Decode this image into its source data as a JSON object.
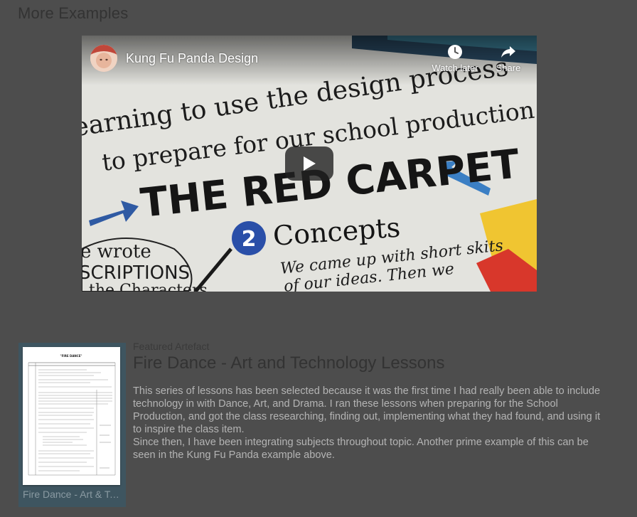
{
  "section": {
    "title": "More Examples"
  },
  "video": {
    "title": "Kung Fu Panda Design",
    "watch_later_label": "Watch later",
    "share_label": "Share",
    "whiteboard_lines": [
      "earning to use the design process",
      "to prepare for our school production",
      "THE RED CARPET",
      "Concepts",
      "We came up with short skits",
      "of our ideas. Then we",
      "e wrote",
      "SCRIPTIONS",
      "the Characters"
    ],
    "whiteboard_number": "2",
    "icons": [
      "clock-icon",
      "share-arrow-icon",
      "play-icon"
    ]
  },
  "featured": {
    "kicker": "Featured Artefact",
    "title": "Fire Dance - Art and Technology Lessons",
    "paragraph_1": "This series of lessons has been selected because it was the first time I had really been able to include technology in with Dance, Art, and Drama. I ran these lessons when preparing for the School Production, and got the class researching, finding out, implementing what they had found, and using it to inspire the class item.",
    "paragraph_2": "Since then, I have been integrating subjects throughout topic. Another prime example of this can be seen in the Kung Fu Panda example above.",
    "card_label": "Fire Dance - Art & Technology Lessons",
    "thumb_heading": "\"FIRE DANCE\""
  },
  "colors": {
    "background": "#4d4d4d",
    "card_background": "#3e5560",
    "body_text": "#b4b4b4",
    "heading_text": "#333333"
  }
}
